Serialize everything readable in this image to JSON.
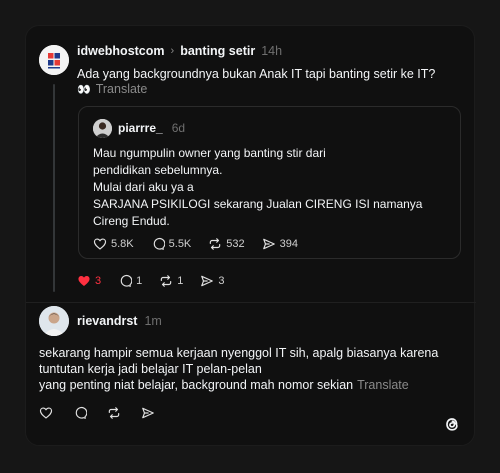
{
  "post": {
    "username": "idwebhostcom",
    "chevron": "›",
    "community": "banting setir",
    "time": "14h",
    "text": "Ada yang backgroundnya bukan Anak IT tapi banting setir ke IT?",
    "translate_label": "Translate",
    "translate_icon": "eyes-icon",
    "quote": {
      "username": "piarrre_",
      "time": "6d",
      "lines": [
        "Mau ngumpulin owner yang banting stir dari",
        "pendidikan sebelumnya.",
        "Mulai dari aku ya a",
        "SARJANA PSIKILOGI sekarang Jualan CIRENG ISI namanya",
        "Cireng Endud."
      ],
      "likes": "5.8K",
      "replies": "5.5K",
      "reposts": "532",
      "shares": "394"
    },
    "likes": "3",
    "replies": "1",
    "reposts": "1",
    "shares": "3",
    "like_color": "#ff3040"
  },
  "reply": {
    "username": "rievandrst",
    "time": "1m",
    "lines": [
      "sekarang hampir semua kerjaan nyenggol IT sih, apalg biasanya karena",
      "tuntutan kerja jadi belajar IT pelan-pelan",
      "yang penting niat belajar, background mah nomor sekian"
    ],
    "translate_label": "Translate"
  },
  "app_logo": "threads-logo-icon"
}
